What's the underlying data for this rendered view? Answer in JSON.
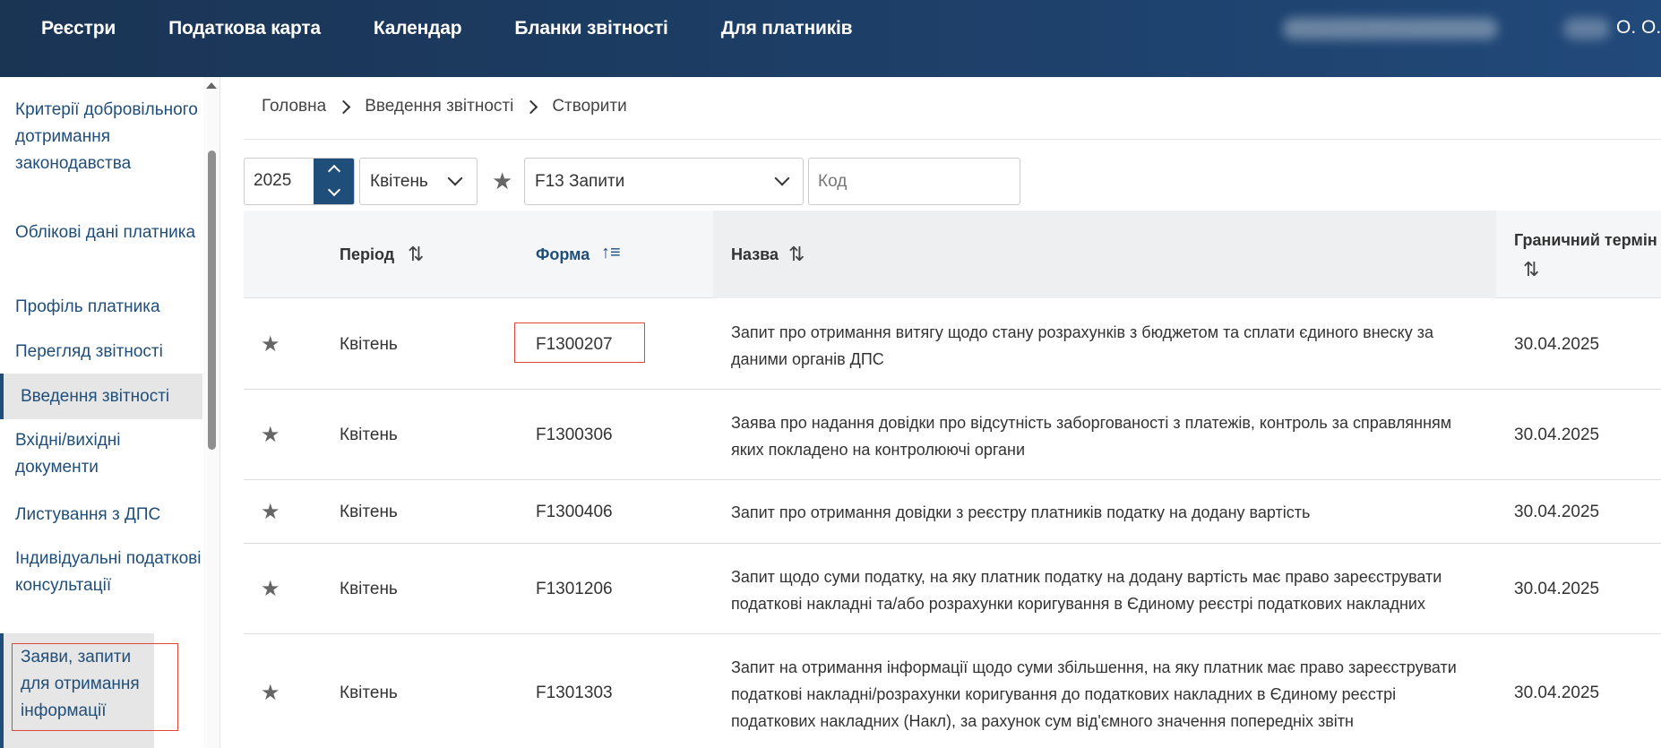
{
  "header": {
    "nav": [
      "Реєстри",
      "Податкова карта",
      "Календар",
      "Бланки звітності",
      "Для платників"
    ],
    "user_initials": "О. О."
  },
  "sidebar": {
    "items": [
      "Критерії добровільного дотримання законодавства",
      "Облікові дані платника",
      "Профіль платника",
      "Перегляд звітності",
      "Введення звітності",
      "Вхідні/вихідні документи",
      "Листування з ДПС",
      "Індивідуальні податкові консультації",
      "Заяви, запити для отримання інформації"
    ],
    "active_item": "Введення звітності",
    "highlighted_item": "Заяви, запити для отримання інформації"
  },
  "breadcrumb": [
    "Головна",
    "Введення звітності",
    "Створити"
  ],
  "filters": {
    "year": "2025",
    "month": "Квітень",
    "form_group": "F13 Запити",
    "code_placeholder": "Код"
  },
  "table": {
    "columns": [
      "Період",
      "Форма",
      "Назва",
      "Граничний термін"
    ],
    "sorted_column": "Форма",
    "rows": [
      {
        "period": "Квітень",
        "form": "F1300207",
        "name": "Запит про отримання витягу щодо стану розрахунків з бюджетом та сплати єдиного внеску за даними органів ДПС",
        "deadline": "30.04.2025",
        "highlighted": true
      },
      {
        "period": "Квітень",
        "form": "F1300306",
        "name": "Заява про надання довідки про відсутність заборгованості з платежів, контроль за справлянням яких покладено на контролюючі органи",
        "deadline": "30.04.2025"
      },
      {
        "period": "Квітень",
        "form": "F1300406",
        "name": "Запит про отримання довідки з реєстру платників податку на додану вартість",
        "deadline": "30.04.2025"
      },
      {
        "period": "Квітень",
        "form": "F1301206",
        "name": "Запит щодо суми податку, на яку платник податку на додану вартість має право зареєструвати податкові накладні та/або розрахунки коригування в Єдиному реєстрі податкових накладних",
        "deadline": "30.04.2025"
      },
      {
        "period": "Квітень",
        "form": "F1301303",
        "name": "Запит на отримання інформації щодо суми збільшення, на яку платник має право зареєструвати податкові накладні/розрахунки коригування до податкових накладних в Єдиному реєстрі податкових накладних (Накл), за рахунок сум від'ємного значення попередніх звітн",
        "deadline": "30.04.2025"
      }
    ]
  },
  "icons": {
    "favorite": "star-icon",
    "sort": "sort-icon",
    "breadcrumb_separator": "chevron-right-icon"
  },
  "colors": {
    "header_bg": "#1d3e66",
    "accent": "#1f4e7a",
    "highlight_border": "#e2463b"
  }
}
